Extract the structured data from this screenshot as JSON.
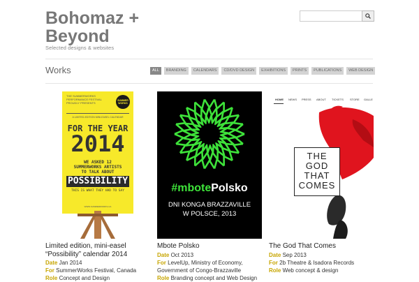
{
  "site": {
    "title": "Bohomaz + Beyond",
    "subtitle": "Selected designs & websites"
  },
  "search": {
    "placeholder": "",
    "button_icon": "magnifier-icon"
  },
  "works": {
    "heading": "Works",
    "filters": [
      {
        "label": "ALL",
        "active": true
      },
      {
        "label": "BRANDING",
        "active": false
      },
      {
        "label": "CALENDARS",
        "active": false
      },
      {
        "label": "CD/DVD DESIGN",
        "active": false
      },
      {
        "label": "EXHIBITIONS",
        "active": false
      },
      {
        "label": "PRINTS",
        "active": false
      },
      {
        "label": "PUBLICATIONS",
        "active": false
      },
      {
        "label": "WEB DESIGN",
        "active": false
      }
    ]
  },
  "projects": [
    {
      "title": "Limited edition, mini-easel “Possibility” calendar 2014",
      "date_label": "Date",
      "date": "Jan 2014",
      "for_label": "For",
      "for": "SummerWorks Festival, Canada",
      "role_label": "Role",
      "role": "Concept and Design",
      "poster": {
        "header": "THE SUMMERWORKS PERFORMANCE FESTIVAL PROUDLY PRESENTS",
        "badge": "SUMMER WORKS",
        "kicker": "A LIMITED-EDITION MINI-EASEL CALENDAR",
        "line1": "FOR THE YEAR",
        "year": "2014",
        "line2": "WE ASKED 12 SUMMERWORKS ARTISTS TO TALK ABOUT",
        "word": "POSSIBILITY",
        "line3": "THIS IS WHAT THEY HAD TO SAY",
        "url": "WWW.SUMMERWORKS.CA",
        "bg": "#f7e92a"
      }
    },
    {
      "title": "Mbote Polsko",
      "date_label": "Date",
      "date": "Oct 2013",
      "for_label": "For",
      "for": "LevelUp, Ministry of Economy, Government of Congo-Brazzaville",
      "role_label": "Role",
      "role": "Branding concept and Web Design",
      "poster": {
        "hashtag_a": "#mbote",
        "hashtag_b": "Polsko",
        "line1": "DNI KONGA BRAZZAVILLE",
        "line2": "W POLSCE, 2013",
        "accent": "#3ee23a",
        "bg": "#000000"
      }
    },
    {
      "title": "The God That Comes",
      "date_label": "Date",
      "date": "Sep 2013",
      "for_label": "For",
      "for": "2b Theatre & Isadora Records",
      "role_label": "Role",
      "role": "Web concept & design",
      "poster": {
        "nav": [
          "HOME",
          "NEWS",
          "PRESS",
          "ABOUT",
          "TICKETS",
          "STORE",
          "GALLE"
        ],
        "t1": "THE",
        "t2": "GOD",
        "t3": "THAT",
        "t4": "COMES",
        "red": "#e0141e"
      }
    }
  ]
}
